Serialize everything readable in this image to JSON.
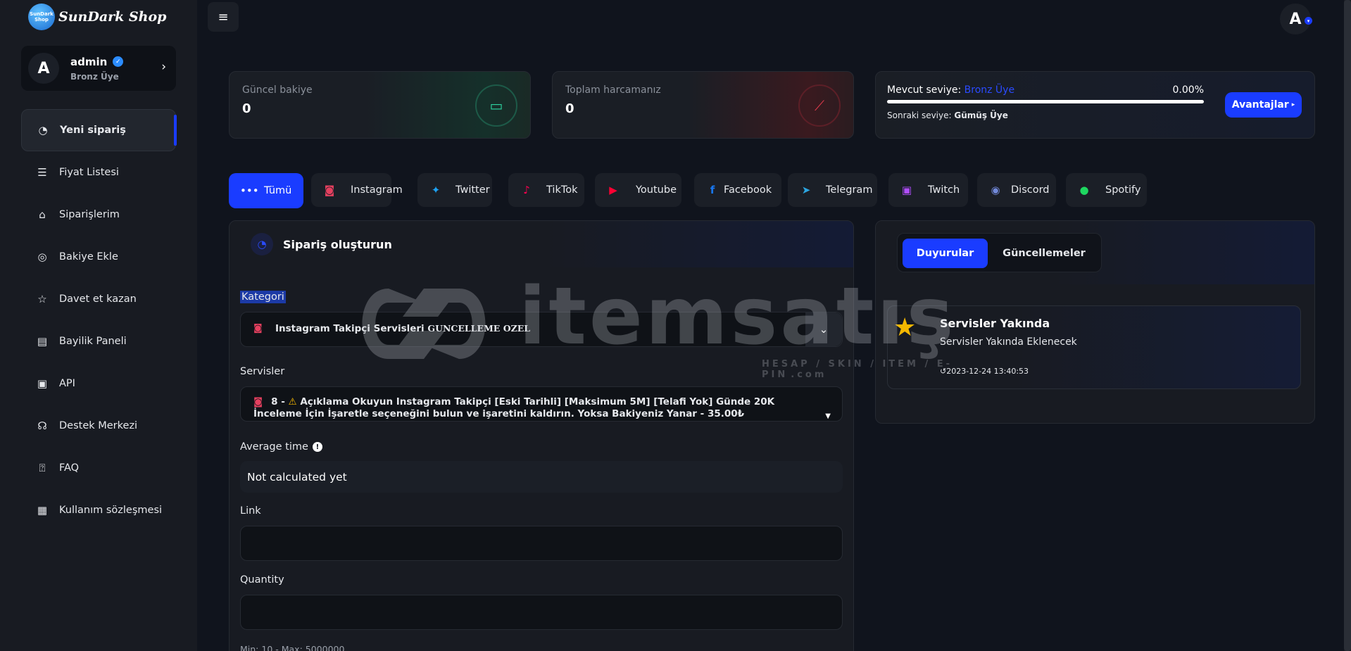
{
  "brand": {
    "logo_badge": "SunDark Shop",
    "name": "SunDark Shop"
  },
  "user": {
    "avatar_letter": "A",
    "name": "admin",
    "role": "Bronz Üye"
  },
  "sidebar": {
    "items": [
      {
        "label": "Yeni sipariş",
        "icon": "gauge-icon",
        "active": true
      },
      {
        "label": "Fiyat Listesi",
        "icon": "list-icon"
      },
      {
        "label": "Siparişlerim",
        "icon": "basket-icon"
      },
      {
        "label": "Bakiye Ekle",
        "icon": "coin-icon"
      },
      {
        "label": "Davet et kazan",
        "icon": "star-icon"
      },
      {
        "label": "Bayilik Paneli",
        "icon": "store-icon"
      },
      {
        "label": "API",
        "icon": "terminal-icon"
      },
      {
        "label": "Destek Merkezi",
        "icon": "headset-icon"
      },
      {
        "label": "FAQ",
        "icon": "question-icon"
      },
      {
        "label": "Kullanım sözleşmesi",
        "icon": "document-icon"
      }
    ]
  },
  "topbar": {
    "avatar_letter": "A"
  },
  "stats": {
    "balance_label": "Güncel bakiye",
    "balance_value": "0",
    "spent_label": "Toplam harcamanız",
    "spent_value": "0"
  },
  "level": {
    "current_label": "Mevcut seviye:",
    "current_name": "Bronz Üye",
    "percent_text": "0.00%",
    "progress_fraction": 1.0,
    "next_label": "Sonraki seviye:",
    "next_name": "Gümüş Üye",
    "button_label": "Avantajlar"
  },
  "platform_tabs": [
    {
      "label": "Tümü",
      "icon": "dots-icon",
      "active": true
    },
    {
      "label": "Instagram",
      "icon": "instagram-icon"
    },
    {
      "label": "Twitter",
      "icon": "twitter-icon"
    },
    {
      "label": "TikTok",
      "icon": "tiktok-icon"
    },
    {
      "label": "Youtube",
      "icon": "youtube-icon"
    },
    {
      "label": "Facebook",
      "icon": "facebook-icon"
    },
    {
      "label": "Telegram",
      "icon": "telegram-icon"
    },
    {
      "label": "Twitch",
      "icon": "twitch-icon"
    },
    {
      "label": "Discord",
      "icon": "discord-icon"
    },
    {
      "label": "Spotify",
      "icon": "spotify-icon"
    }
  ],
  "order_form": {
    "title": "Sipariş oluşturun",
    "category_label": "Kategori",
    "category_value": "Instagram Takipçi Servisleri",
    "category_suffix": "GUNCELLEME OZEL",
    "services_label": "Servisler",
    "service_prefix": "8 -",
    "service_value": "Açıklama Okuyun Instagram Takipçi [Eski Tarihli] [Maksimum 5M] [Telafi Yok] Günde 20K İnceleme İçin İşaretle seçeneğini bulun ve işaretini kaldırın. Yoksa Bakiyeniz Yanar - 35.00₺",
    "avg_time_label": "Average time",
    "avg_time_value": "Not calculated yet",
    "link_label": "Link",
    "link_value": "",
    "quantity_label": "Quantity",
    "quantity_value": "",
    "minmax_text": "Min: 10 - Max: 5000000"
  },
  "announcements": {
    "tabs": [
      {
        "label": "Duyurular",
        "active": true
      },
      {
        "label": "Güncellemeler"
      }
    ],
    "items": [
      {
        "title": "Servisler Yakında",
        "desc": "Servisler Yakında Eklenecek",
        "date": "2023-12-24 13:40:53"
      }
    ]
  },
  "watermark": {
    "text": "itemsatış",
    "sub": "HESAP / SKIN / ITEM / E-PIN",
    "domain": ".com"
  },
  "colors": {
    "accent": "#1a3cff",
    "background": "#10141d",
    "sidebar": "#181b22",
    "star": "#f5b800",
    "instagram": "#e4405f"
  }
}
